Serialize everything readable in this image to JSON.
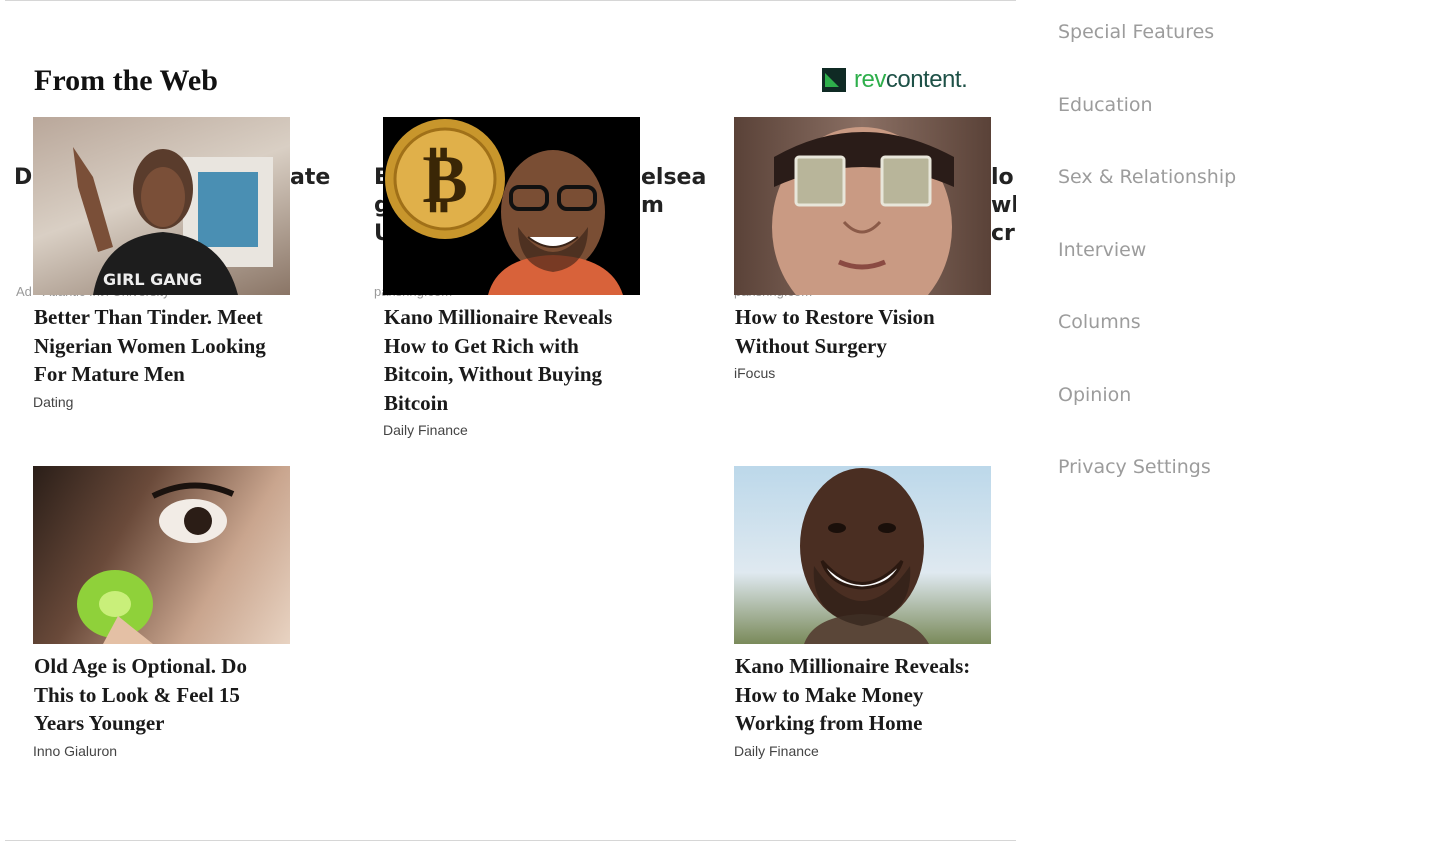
{
  "widget": {
    "heading": "From the Web",
    "provider": {
      "name": "revcontent",
      "part1": "rev",
      "part2": "content."
    },
    "cards": [
      {
        "title": "Better Than Tinder. Meet Nigerian Women Looking For Mature Men",
        "source": "Dating"
      },
      {
        "title": "Kano Millionaire Reveals How to Get Rich with Bitcoin, Without Buying Bitcoin",
        "source": "Daily Finance"
      },
      {
        "title": "How to Restore Vision Without Surgery",
        "source": "iFocus"
      },
      {
        "title": "Old Age is Optional. Do This to Look & Feel 15 Years Younger",
        "source": "Inno Gialuron"
      },
      {
        "title": "Kano Millionaire Reveals: How to Make Money Working from Home",
        "source": "Daily Finance"
      }
    ],
    "background_fragments": {
      "a": "Do",
      "b": "ate",
      "c": "E",
      "d": "elsea",
      "e": "g",
      "f": "m",
      "g": "U",
      "h": "lo t",
      "i": "wh",
      "j": "cri",
      "k": "Ad · Atlantic Int'l University",
      "l": "parlshng.com",
      "m": "parlshng.com"
    }
  },
  "sidebar": {
    "items": [
      "Special Features",
      "Education",
      "Sex & Relationship",
      "Interview",
      "Columns",
      "Opinion",
      "Privacy Settings"
    ]
  },
  "icons": {
    "bitcoin": "bitcoin-coin-icon",
    "logo": "revcontent-logo-icon"
  },
  "colors": {
    "accent": "#2eaf4b",
    "sidebar_text": "#9c9c9c",
    "title_text": "#1a1a1a"
  }
}
